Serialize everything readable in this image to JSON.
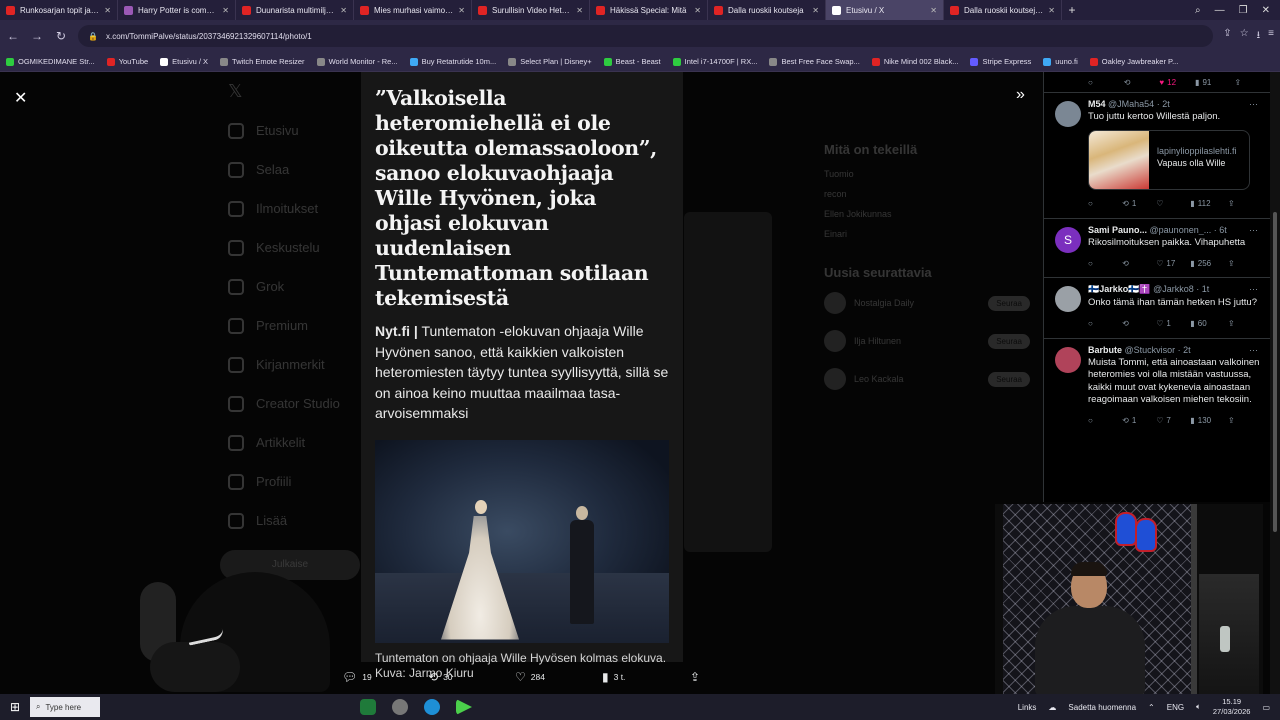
{
  "browser": {
    "tabs": [
      {
        "label": "Runkosarjan topit ja flopit",
        "color": "#e02424",
        "active": false
      },
      {
        "label": "Harry Potter is completely",
        "color": "#9b59b6",
        "active": false
      },
      {
        "label": "Duunarista multimiljonääriksi",
        "color": "#e02424",
        "active": false
      },
      {
        "label": "Mies murhasi vaimonsa",
        "color": "#e02424",
        "active": false
      },
      {
        "label": "Surullisin Video Hetkeen",
        "color": "#e02424",
        "active": false
      },
      {
        "label": "Häkissä Special: Mitä",
        "color": "#e02424",
        "active": false
      },
      {
        "label": "Dalla ruoskii koutseja",
        "color": "#e02424",
        "active": false
      },
      {
        "label": "Etusivu / X",
        "color": "#ffffff",
        "active": true
      },
      {
        "label": "Dalla ruoskii koutseja + ka",
        "color": "#e02424",
        "active": false
      }
    ],
    "url": "x.com/TommiPalve/status/2037346921329607114/photo/1",
    "bookmarks": [
      {
        "label": "OGMIKEDIMANE Str...",
        "color": "#2ecc40"
      },
      {
        "label": "YouTube",
        "color": "#e02424"
      },
      {
        "label": "Etusivu / X",
        "color": "#ffffff"
      },
      {
        "label": "Twitch Emote Resizer",
        "color": "#888888"
      },
      {
        "label": "World Monitor - Re...",
        "color": "#888888"
      },
      {
        "label": "Buy Retatrutide 10m...",
        "color": "#3fa9f5"
      },
      {
        "label": "Select Plan | Disney+",
        "color": "#888888"
      },
      {
        "label": "Beast - Beast",
        "color": "#2ecc40"
      },
      {
        "label": "Intel i7-14700F | RX...",
        "color": "#2ecc40"
      },
      {
        "label": "Best Free Face Swap...",
        "color": "#888888"
      },
      {
        "label": "Nike Mind 002 Black...",
        "color": "#e02424"
      },
      {
        "label": "Stripe Express",
        "color": "#635bff"
      },
      {
        "label": "uuno.fi",
        "color": "#3fa9f5"
      },
      {
        "label": "Oakley Jawbreaker P...",
        "color": "#e02424"
      }
    ]
  },
  "background": {
    "nav": [
      "Etusivu",
      "Selaa",
      "Ilmoitukset",
      "Keskustelu",
      "Grok",
      "Premium",
      "Kirjanmerkit",
      "Creator Studio",
      "Artikkelit",
      "Profiili",
      "Lisää"
    ],
    "post_button": "Julkaise",
    "trends_title": "Mitä on tekeillä",
    "trends": [
      "Tuomio",
      "recon",
      "Ellen Jokikunnas",
      "Einari"
    ],
    "follow_title": "Uusia seurattavia",
    "follow": [
      "Nostalgia Daily",
      "Ilja Hiltunen",
      "Leo Kackala"
    ],
    "follow_button": "Seuraa"
  },
  "article": {
    "headline": "”Valkoisella heteromiehellä ei ole oikeutta olemassaoloon”, sanoo elokuvaohjaaja Wille Hyvönen, joka ohjasi elokuvan uudenlaisen Tuntemattoman sotilaan tekemisestä",
    "source": "Nyt.fi |",
    "lead": " Tuntematon -elokuvan ohjaaja Wille Hyvönen sanoo, että kaikkien valkoisten heteromiesten täytyy tuntea syyllisyyttä, sillä se on ainoa keino muuttaa maailmaa tasa-arvoisemmaksi",
    "caption": "Tuntematon on ohjaaja Wille Hyvösen kolmas elokuva. Kuva: Jarmo Kiuru"
  },
  "post_actions": {
    "replies": "19",
    "reposts": "30",
    "likes": "284",
    "views": "3 t."
  },
  "replies": {
    "top_stats": {
      "likes": "12",
      "views": "91"
    },
    "items": [
      {
        "name": "M54",
        "handle": "@JMaha54 · 2t",
        "text": "Tuo juttu kertoo Willestä paljon.",
        "avatar": "#7b8794",
        "card": {
          "domain": "lapinylioppilaslehti.fi",
          "title": "Vapaus olla Wille"
        },
        "stats": {
          "reposts": "1",
          "likes": "",
          "views": "112"
        }
      },
      {
        "name": "Sami Pauno...",
        "handle": "@paunonen_... · 6t",
        "text": "Rikosilmoituksen paikka. Vihapuhetta",
        "avatar": "#7b2fbe",
        "initial": "S",
        "stats": {
          "reposts": "",
          "likes": "17",
          "views": "256"
        }
      },
      {
        "name": "🇫🇮Jarkko🇫🇮✝️",
        "handle": "@Jarkko8 · 1t",
        "text": "Onko tämä ihan tämän hetken HS juttu?",
        "avatar": "#9aa0a6",
        "stats": {
          "reposts": "",
          "likes": "1",
          "views": "60"
        }
      },
      {
        "name": "Barbute",
        "handle": "@Stuckvisor · 2t",
        "text": "Muista Tommi, että ainoastaan valkoinen heteromies voi olla mistään vastuussa, kaikki muut ovat kykenevia ainoastaan reagoimaan valkoisen miehen tekosiin.",
        "avatar": "#b0435a",
        "stats": {
          "reposts": "1",
          "likes": "7",
          "views": "130"
        }
      }
    ]
  },
  "taskbar": {
    "search_placeholder": "Type here",
    "links": "Links",
    "weather": "Sadetta huomenna",
    "lang": "ENG",
    "time": "15.19",
    "date": "27/03/2026"
  },
  "colors": {
    "accent_pink": "#f91880",
    "muted": "#8b98a5",
    "overlay_bg": "#050505"
  }
}
